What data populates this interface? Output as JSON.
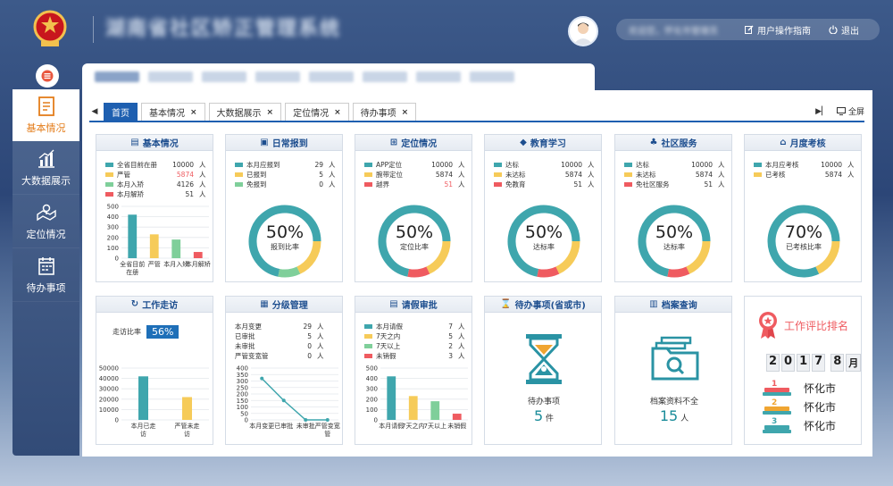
{
  "header": {
    "system_title": "湖南省社区矫正管理系统",
    "user_name": "欢迎您，怀化市管理员",
    "guide_label": "用户操作指南",
    "logout_label": "退出"
  },
  "sidebar": {
    "items": [
      {
        "label": "基本情况",
        "icon": "document-icon"
      },
      {
        "label": "大数据展示",
        "icon": "chart-icon"
      },
      {
        "label": "定位情况",
        "icon": "map-icon"
      },
      {
        "label": "待办事项",
        "icon": "calendar-icon"
      }
    ]
  },
  "tabs": {
    "items": [
      "首页",
      "基本情况",
      "大数据展示",
      "定位情况",
      "待办事项"
    ],
    "fullscreen_label": "全屏"
  },
  "colors": {
    "accent": "#1e5fb0",
    "teal": "#3fa6ad",
    "yellow": "#f6cb59",
    "green": "#7fcf9a",
    "red": "#ef5b60",
    "orange": "#e47d1b"
  },
  "cards": {
    "basic": {
      "title": "基本情况",
      "legend": [
        {
          "label": "全省目前在册",
          "value": "10000",
          "unit": "人",
          "color": "#3fa6ad"
        },
        {
          "label": "严管",
          "value": "5874",
          "unit": "人",
          "color": "#f6cb59",
          "value_color": "#ef5b60"
        },
        {
          "label": "本月入矫",
          "value": "4126",
          "unit": "人",
          "color": "#7fcf9a"
        },
        {
          "label": "本月解矫",
          "value": "51",
          "unit": "人",
          "color": "#ef5b60"
        }
      ]
    },
    "checkin": {
      "title": "日常报到",
      "legend": [
        {
          "label": "本月应报到",
          "value": "29",
          "unit": "人",
          "color": "#3fa6ad"
        },
        {
          "label": "已报到",
          "value": "5",
          "unit": "人",
          "color": "#f6cb59"
        },
        {
          "label": "免报到",
          "value": "0",
          "unit": "人",
          "color": "#7fcf9a"
        }
      ],
      "percent": "50%",
      "percent_label": "报到比率"
    },
    "location": {
      "title": "定位情况",
      "legend": [
        {
          "label": "APP定位",
          "value": "10000",
          "unit": "人",
          "color": "#3fa6ad"
        },
        {
          "label": "腕带定位",
          "value": "5874",
          "unit": "人",
          "color": "#f6cb59"
        },
        {
          "label": "越界",
          "value": "51",
          "unit": "人",
          "color": "#ef5b60",
          "value_color": "#ef5b60"
        }
      ],
      "percent": "50%",
      "percent_label": "定位比率"
    },
    "education": {
      "title": "教育学习",
      "legend": [
        {
          "label": "达标",
          "value": "10000",
          "unit": "人",
          "color": "#3fa6ad"
        },
        {
          "label": "未达标",
          "value": "5874",
          "unit": "人",
          "color": "#f6cb59"
        },
        {
          "label": "免教育",
          "value": "51",
          "unit": "人",
          "color": "#ef5b60"
        }
      ],
      "percent": "50%",
      "percent_label": "达标率"
    },
    "community": {
      "title": "社区服务",
      "legend": [
        {
          "label": "达标",
          "value": "10000",
          "unit": "人",
          "color": "#3fa6ad"
        },
        {
          "label": "未达标",
          "value": "5874",
          "unit": "人",
          "color": "#f6cb59"
        },
        {
          "label": "免社区服务",
          "value": "51",
          "unit": "人",
          "color": "#ef5b60"
        }
      ],
      "percent": "50%",
      "percent_label": "达标率"
    },
    "monthly": {
      "title": "月度考核",
      "legend": [
        {
          "label": "本月应考核",
          "value": "10000",
          "unit": "人",
          "color": "#3fa6ad"
        },
        {
          "label": "已考核",
          "value": "5874",
          "unit": "人",
          "color": "#f6cb59"
        }
      ],
      "percent": "70%",
      "percent_label": "已考核比率"
    },
    "visits": {
      "title": "工作走访",
      "rate_label": "走访比率",
      "rate_value": "56%"
    },
    "grading": {
      "title": "分级管理",
      "legend": [
        {
          "label": "本月变更",
          "value": "29",
          "unit": "人"
        },
        {
          "label": "已审批",
          "value": "5",
          "unit": "人"
        },
        {
          "label": "未审批",
          "value": "0",
          "unit": "人"
        },
        {
          "label": "严管变宽管",
          "value": "0",
          "unit": "人"
        }
      ]
    },
    "leave": {
      "title": "请假审批",
      "legend": [
        {
          "label": "本月请假",
          "value": "7",
          "unit": "人",
          "color": "#3fa6ad"
        },
        {
          "label": "7天之内",
          "value": "5",
          "unit": "人",
          "color": "#f6cb59"
        },
        {
          "label": "7天以上",
          "value": "2",
          "unit": "人",
          "color": "#7fcf9a"
        },
        {
          "label": "未销假",
          "value": "3",
          "unit": "人",
          "color": "#ef5b60"
        }
      ]
    },
    "todo": {
      "title": "待办事项(省或市)",
      "label": "待办事项",
      "value": "5",
      "unit": "件"
    },
    "archive": {
      "title": "档案查询",
      "label": "档案资料不全",
      "value": "15",
      "unit": "人"
    },
    "ranking": {
      "title": "工作评比排名",
      "date": [
        "2",
        "0",
        "1",
        "7",
        "8",
        "月"
      ],
      "items": [
        {
          "rank": "1",
          "city": "怀化市",
          "color": "#ef5b60"
        },
        {
          "rank": "2",
          "city": "怀化市",
          "color": "#f0a531"
        },
        {
          "rank": "3",
          "city": "怀化市",
          "color": "#3fa6ad"
        }
      ]
    }
  },
  "chart_data": [
    {
      "type": "bar",
      "categories": [
        "全省目前在册",
        "严管",
        "本月入矫",
        "本月解矫"
      ],
      "values": [
        420,
        230,
        180,
        60
      ],
      "colors": [
        "#3fa6ad",
        "#f6cb59",
        "#7fcf9a",
        "#ef5b60"
      ],
      "yticks": [
        0,
        100,
        200,
        300,
        400,
        500
      ],
      "ylim": [
        0,
        500
      ]
    },
    {
      "type": "bar",
      "categories": [
        "本月已走访",
        "严管未走访"
      ],
      "values": [
        42000,
        22000
      ],
      "colors": [
        "#3fa6ad",
        "#f6cb59"
      ],
      "yticks": [
        0,
        10000,
        20000,
        30000,
        40000,
        50000
      ],
      "ylim": [
        0,
        50000
      ]
    },
    {
      "type": "line",
      "categories": [
        "本月变更",
        "已审批",
        "未审批",
        "严管变宽管"
      ],
      "values": [
        320,
        150,
        0,
        0
      ],
      "color": "#3fa6ad",
      "yticks": [
        0,
        50,
        100,
        150,
        200,
        250,
        300,
        350,
        400
      ],
      "ylim": [
        0,
        400
      ]
    },
    {
      "type": "bar",
      "categories": [
        "本月请假",
        "7天之内",
        "7天以上",
        "未销假"
      ],
      "values": [
        420,
        230,
        180,
        60
      ],
      "colors": [
        "#3fa6ad",
        "#f6cb59",
        "#7fcf9a",
        "#ef5b60"
      ],
      "yticks": [
        0,
        100,
        200,
        300,
        400,
        500
      ],
      "ylim": [
        0,
        500
      ]
    }
  ]
}
